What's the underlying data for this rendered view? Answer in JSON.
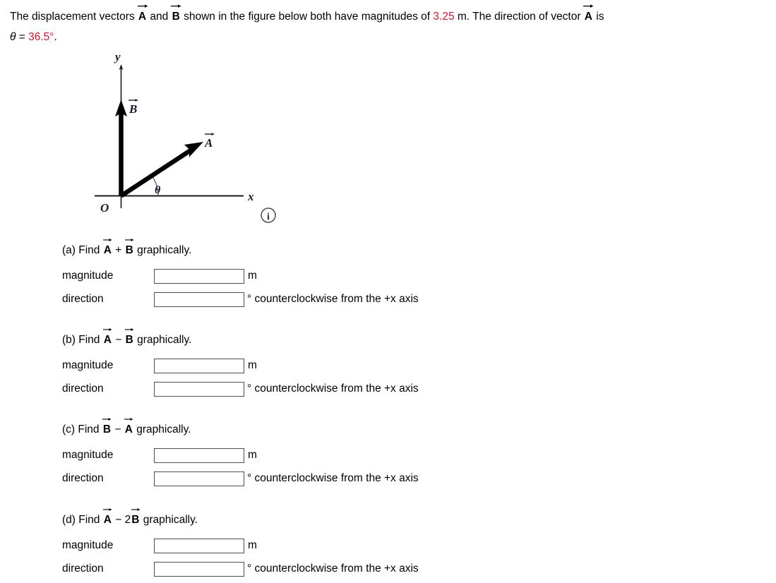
{
  "problem": {
    "text_1": "The displacement vectors ",
    "vec_a": "A",
    "text_2": " and ",
    "vec_b": "B",
    "text_3": " shown in the figure below both have magnitudes of ",
    "magnitude_value": "3.25",
    "text_4": " m. The direction of vector ",
    "vec_a2": "A",
    "text_5": " is",
    "theta_symbol": "θ",
    "theta_equals": " = ",
    "theta_value": "36.5°",
    "theta_period": "."
  },
  "figure": {
    "x_axis_label": "x",
    "y_axis_label": "y",
    "origin_label": "O",
    "vector_a_label": "A",
    "vector_b_label": "B",
    "angle_label": "θ",
    "info_icon": "info-icon",
    "info_icon_glyph": "i"
  },
  "colors": {
    "highlight": "#e8112d",
    "text": "#000000",
    "box_border": "#4d4d4d",
    "figure_label": "#1a1a2e"
  },
  "parts": [
    {
      "id": "a",
      "prefix": "(a) Find ",
      "operand_1": "A",
      "operator": "+",
      "operand_2": "B",
      "suffix": " graphically.",
      "magnitude_label": "magnitude",
      "magnitude_value": "",
      "magnitude_unit": "m",
      "direction_label": "direction",
      "direction_value": "",
      "direction_unit": "° counterclockwise from the +x axis"
    },
    {
      "id": "b",
      "prefix": "(b) Find ",
      "operand_1": "A",
      "operator": "−",
      "operand_2": "B",
      "suffix": " graphically.",
      "magnitude_label": "magnitude",
      "magnitude_value": "",
      "magnitude_unit": "m",
      "direction_label": "direction",
      "direction_value": "",
      "direction_unit": "° counterclockwise from the +x axis"
    },
    {
      "id": "c",
      "prefix": "(c) Find ",
      "operand_1": "B",
      "operator": "−",
      "operand_2": "A",
      "suffix": " graphically.",
      "magnitude_label": "magnitude",
      "magnitude_value": "",
      "magnitude_unit": "m",
      "direction_label": "direction",
      "direction_value": "",
      "direction_unit": "° counterclockwise from the +x axis"
    },
    {
      "id": "d",
      "prefix": "(d) Find ",
      "operand_1": "A",
      "operator": "−",
      "operand_2_coefficient": "2",
      "operand_2": "B",
      "suffix": " graphically.",
      "magnitude_label": "magnitude",
      "magnitude_value": "",
      "magnitude_unit": "m",
      "direction_label": "direction",
      "direction_value": "",
      "direction_unit": "° counterclockwise from the +x axis"
    }
  ]
}
